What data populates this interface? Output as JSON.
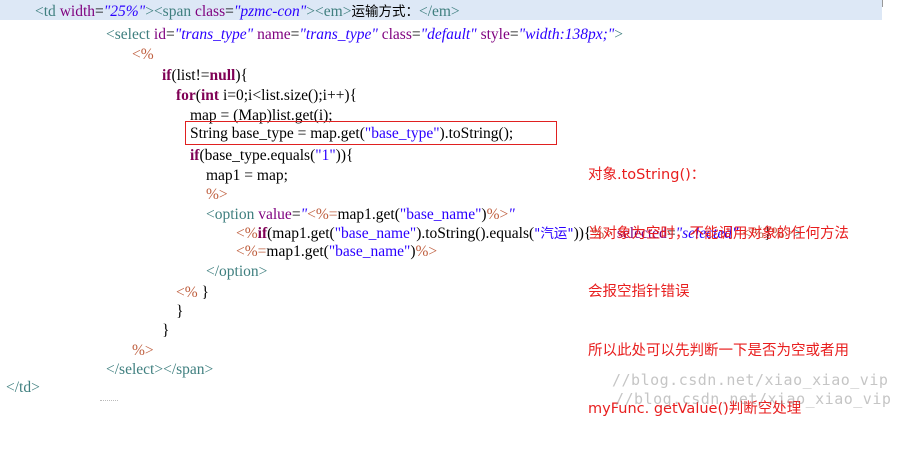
{
  "code": {
    "line1": {
      "open": "<td ",
      "a1": "width",
      "eq": "=",
      "v1": "\"25%\"",
      "close1": ">",
      "span_open": "<span ",
      "a2": "class",
      "v2": "\"pzmc-con\"",
      "close2": ">",
      "em_open": "<em>",
      "text": "运输方式：",
      "em_close": "</em>"
    },
    "line2": {
      "open": "<select ",
      "a1": "id",
      "v1": "\"trans_type\"",
      "a2": "name",
      "v2": "\"trans_type\"",
      "a3": "class",
      "v3": "\"default\"",
      "a4": "style",
      "v4": "\"width:138px;\"",
      "close": ">"
    },
    "line3": "<%",
    "line4": {
      "kw": "if",
      "rest": "(list!=",
      "kw2": "null",
      "rest2": "){"
    },
    "line5": {
      "kw": "for",
      "p1": "(",
      "kw2": "int",
      "rest": " i=0;i<list.size();i++){"
    },
    "line6": "map = (Map)list.get(i);",
    "line7": {
      "pre": "String base_type = map.get(",
      "str": "\"base_type\"",
      "post": ").toString();"
    },
    "line8": {
      "kw": "if",
      "pre": "(base_type.equals(",
      "str": "\"1\"",
      "post": ")){"
    },
    "line9": "map1 = map;",
    "line10": "%>",
    "line11": {
      "tag": "<option ",
      "attr": "value",
      "eq": "=",
      "q": "\"",
      "jsp": "<%=",
      "code": "map1.get(",
      "str": "\"base_name\"",
      "code2": ")",
      "jsp2": "%>",
      "q2": "\""
    },
    "line12": {
      "jsp": "<%",
      "kw": "if",
      "code": "(map1.get(",
      "str": "\"base_name\"",
      "code2": ").toString().equals(",
      "str2": "\"汽运\"",
      "code3": ")){",
      "jsp2": "%>",
      "sp": " ",
      "attr": "selected",
      "eq": "=",
      "val": "\"selected\"",
      "sp2": " ",
      "jsp3": "<%",
      "code4": "}",
      "jsp4": "%>",
      "tag": ">"
    },
    "line13": {
      "jsp": "<%=",
      "code": "map1.get(",
      "str": "\"base_name\"",
      "code2": ")",
      "jsp2": "%>"
    },
    "line14": "</option>",
    "line15": {
      "jsp": "<%",
      "code": " }"
    },
    "line16": "}",
    "line17": "}",
    "line18": "%>",
    "line19": "</select></span>",
    "line20": "</td>"
  },
  "annotation": {
    "line1": "对象.toString()：",
    "line2": "当对象为空时，不能调用对象的任何方法",
    "line3": "会报空指针错误",
    "line4": "所以此处可以先判断一下是否为空或者用",
    "line5": "myFunc. getValue()判断空处理"
  },
  "watermark": "//blog.csdn.net/xiao_xiao_vip",
  "colors": {
    "tag": "#3f7f7f",
    "attribute": "#7f007f",
    "attribute_value": "#2a00ff",
    "jsp_delimiter": "#bf5f3f",
    "keyword": "#7f0055",
    "annotation": "#e81e1e",
    "highlight_line": "#dde8f6"
  }
}
